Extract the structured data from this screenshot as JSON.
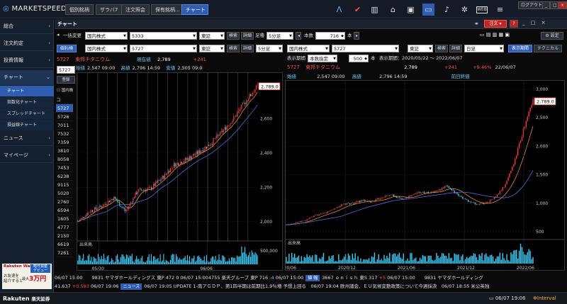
{
  "app": {
    "logo_main": "MARKETSPEED",
    "logo_suffix": "II"
  },
  "top_tabs": [
    {
      "label": "個別銘柄"
    },
    {
      "label": "ザラバ7"
    },
    {
      "label": "注文照会"
    },
    {
      "label": "保有銘柄..."
    },
    {
      "label": "チャート"
    }
  ],
  "top_icons": {
    "web_label": "WEB",
    "logout_label": "ログアウト"
  },
  "sidebar": {
    "items": [
      {
        "label": "総合"
      },
      {
        "label": "注文約定"
      },
      {
        "label": "投資情報"
      },
      {
        "label": "チャート"
      },
      {
        "label": "ニュース"
      },
      {
        "label": "マイページ"
      }
    ],
    "subitems": [
      {
        "label": "チャート"
      },
      {
        "label": "指数化チャート"
      },
      {
        "label": "スプレッドチャート"
      },
      {
        "label": "損益線チャート"
      }
    ],
    "ad": {
      "brand": "Rakuten Wallet",
      "line1": "暗号資産",
      "line2": "デビュー",
      "line3": "お友達を",
      "line4": "紹介すると",
      "line5": "最大",
      "amount": "3万円"
    }
  },
  "window": {
    "title": "チャート",
    "order_label": "注文",
    "help_label": "?",
    "settings_label": "設定"
  },
  "toolbar": {
    "bulk_change": "一括変更",
    "market": "国内株式",
    "code": "5333",
    "exchange": "東証",
    "search": "検索",
    "detail": "詳細",
    "foot_label": "足種",
    "foot": "5分足",
    "count_label": "本数",
    "count": "716",
    "count_unit": "本"
  },
  "left_chart": {
    "tab": "個別/検",
    "market": "国内株式",
    "code": "5727",
    "exchange": "東証",
    "search": "検索",
    "detail": "詳細",
    "foot": "5分足",
    "input_code": "5727",
    "symbol_code": "5727",
    "symbol_name": "東邦チタニウム",
    "current_label": "現在値",
    "current_value": "2,789",
    "change": "+241",
    "open_label": "始値",
    "open_value": "2,547 09:00",
    "high_label": "高値",
    "high_value": "2,796 14:59",
    "low_label": "安値",
    "low_value": "2,505 09:0",
    "registered_label": "登録",
    "domestic_label": "国内株",
    "list_header": "コ",
    "codes": [
      "5727",
      "5726",
      "7011",
      "7532",
      "7359",
      "3810",
      "8058",
      "7453",
      "6238",
      "9115",
      "5020",
      "2760",
      "6594",
      "1605",
      "4777",
      "2150",
      "6619",
      "7261"
    ],
    "price_tag": "2,789.0",
    "yticks": [
      "2,600",
      "2,400",
      "2,200",
      "2,000"
    ],
    "xticks": [
      "05/30",
      "06/06"
    ],
    "volume_label": "出来高",
    "volume_tick": "500,000"
  },
  "right_chart": {
    "market": "国内株式",
    "code": "5727",
    "exchange": "東証",
    "search": "検索",
    "detail": "詳細",
    "foot": "日足",
    "display_period_btn": "表示期間",
    "technical_btn": "テクニカル",
    "period_label": "表示期間",
    "period_mode": "本数指定",
    "count": "500",
    "count_unit": "本",
    "period_text_label": "表示期間：",
    "period_text": "2020/05/22 ～ 2022/06/07",
    "symbol_code": "5727",
    "symbol_name": "東邦チタニウム",
    "current_value": "2,789",
    "change": "+241",
    "change_pct": "+9.46%",
    "date": "22/06/07",
    "open_label": "始値",
    "open_value": "2,547 09:00",
    "high_label": "高値",
    "high_value": "2,796 14:59",
    "prev_label": "前日終値",
    "price_tag": "2,789.0",
    "yticks": [
      "3,000",
      "2,500",
      "2,000",
      "1,500",
      "1,000",
      "500"
    ],
    "xticks": [
      "2020/06",
      "2020/12",
      "2021/06",
      "2021/12",
      "2022/06"
    ],
    "volume_label": "出来高"
  },
  "ticker1": [
    {
      "text": "06/07 15:00　　9831 ヤマダホールディングス 東P 472 0 06/07 15:00"
    },
    {
      "text": "4755 楽天グループ 東P 716 "
    },
    {
      "text": "-4",
      "color": "#4ec9ff"
    },
    {
      "text": " 06/07 15:00"
    },
    {
      "badge": "値 幅"
    },
    {
      "text": "3667 ｅｎｉｓｈ 東S 317 "
    },
    {
      "text": "+5",
      "color": "#ff4e4e"
    },
    {
      "text": " 06/07 15:00　　9831 ヤマダホールディング"
    }
  ],
  "ticker2": [
    {
      "text": "41.637 "
    },
    {
      "text": "+0.593",
      "color": "#ff4e4e"
    },
    {
      "text": " 06/07 19:06"
    },
    {
      "badge": "ニュース"
    },
    {
      "text": "06/07 19:05 UPDATE 1-南アＧＤＰ、第1四半期は前期比1.9％増 予想上回る　06/07 19:04 欧州議会、ＥＵ気候変動政策について今週採決　06/07 18:55 米公英独"
    }
  ],
  "status": {
    "brand": "Rakuten",
    "brand2": "楽天証券",
    "clock": "06/07 19:06",
    "interval": "Interval"
  },
  "chart_data": [
    {
      "type": "line",
      "title": "",
      "symbol": "5727 東邦チタニウム",
      "timeframe": "5分足",
      "x": [
        "05/30",
        "06/06"
      ],
      "ylim": [
        1900,
        2850
      ],
      "series": [
        {
          "values": [
            2000,
            2060,
            2090,
            2140,
            2060,
            2180,
            2190,
            2250,
            2330,
            2360,
            2400,
            2450,
            2520,
            2600,
            2700,
            2789
          ]
        }
      ],
      "last": 2789.0
    },
    {
      "type": "line",
      "title": "",
      "symbol": "5727 東邦チタニウム",
      "timeframe": "日足",
      "x": [
        "2020/06",
        "2020/12",
        "2021/06",
        "2021/12",
        "2022/06"
      ],
      "ylim": [
        400,
        3100
      ],
      "series": [
        {
          "values": [
            620,
            660,
            700,
            780,
            820,
            900,
            980,
            1000,
            1050,
            1020,
            1100,
            1150,
            1080,
            1120,
            1200,
            1180,
            1220,
            1300,
            1150,
            1050,
            980,
            1000,
            1100,
            1300,
            1700,
            2300,
            2789
          ]
        }
      ],
      "last": 2789.0
    }
  ]
}
